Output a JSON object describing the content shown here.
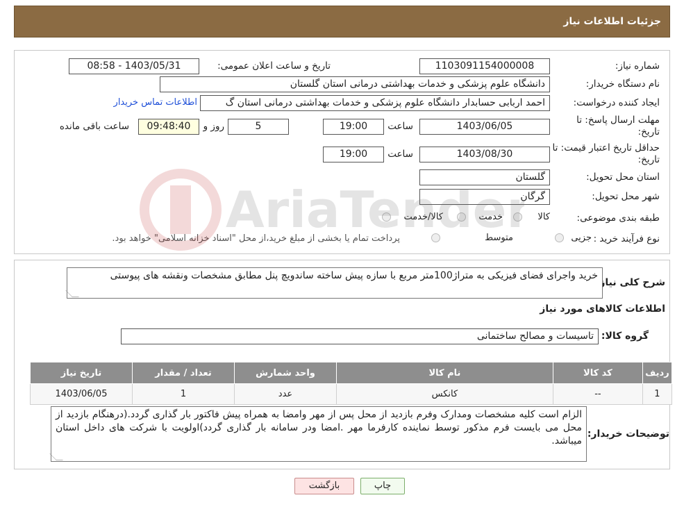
{
  "header": {
    "title": "جزئیات اطلاعات نیاز"
  },
  "details": {
    "need_number_label": "شماره نیاز:",
    "need_number": "1103091154000008",
    "announce_label": "تاریخ و ساعت اعلان عمومی:",
    "announce_value": "1403/05/31 - 08:58",
    "buyer_org_label": "نام دستگاه خریدار:",
    "buyer_org": "دانشگاه علوم پزشکی و خدمات بهداشتی درمانی استان گلستان",
    "requester_label": "ایجاد کننده درخواست:",
    "requester": "احمد اربابی حسابدار دانشگاه علوم پزشکی و خدمات بهداشتی درمانی استان گ",
    "contact_link": "اطلاعات تماس خریدار",
    "deadline_label": "مهلت ارسال پاسخ: تا تاریخ:",
    "deadline_date": "1403/06/05",
    "time_label": "ساعت",
    "deadline_time": "19:00",
    "days_value": "5",
    "days_label": "روز و",
    "remaining_time": "09:48:40",
    "remaining_label": "ساعت باقی مانده",
    "validity_label": "حداقل تاریخ اعتبار قیمت: تا تاریخ:",
    "validity_date": "1403/08/30",
    "validity_time": "19:00",
    "province_label": "استان محل تحویل:",
    "province": "گلستان",
    "city_label": "شهر محل تحویل:",
    "city": "گرگان",
    "category_label": "طبقه بندی موضوعی:",
    "category_options": [
      "کالا",
      "خدمت",
      "کالا/خدمت"
    ],
    "process_label": "نوع فرآیند خرید :",
    "process_options": [
      "جزیی",
      "متوسط"
    ],
    "payment_note": "پرداخت تمام یا بخشی از مبلغ خرید،از محل \"اسناد خزانه اسلامی\" خواهد بود."
  },
  "summary": {
    "desc_label": "شرح کلی نیاز:",
    "desc_text": "خرید واجرای فضای فیزیکی به متراژ100متر مربع با سازه پیش ساخته ساندویچ پنل مطابق مشخصات ونقشه های پیوستی",
    "goods_title": "اطلاعات کالاهای مورد نیاز",
    "group_label": "گروه کالا:",
    "group_value": "تاسیسات و مصالح ساختمانی"
  },
  "table": {
    "headers": [
      "ردیف",
      "کد کالا",
      "نام کالا",
      "واحد شمارش",
      "تعداد / مقدار",
      "تاریخ نیاز"
    ],
    "rows": [
      [
        "1",
        "--",
        "کانکس",
        "عدد",
        "1",
        "1403/06/05"
      ]
    ]
  },
  "buyer_notes": {
    "label": "توضیحات خریدار:",
    "text": "الزام است کلیه مشخصات ومدارک وفرم بازدید از محل پس از مهر وامضا به همراه پیش فاکتور بار گذاری گردد.(درهنگام بازدید از محل می بایست فرم مذکور توسط نماینده کارفرما مهر .امضا ودر سامانه بار گذاری گردد)اولویت با شرکت های داخل استان میباشد."
  },
  "buttons": {
    "print": "چاپ",
    "back": "بازگشت"
  },
  "watermark": {
    "text": "AriaTender.neT"
  }
}
